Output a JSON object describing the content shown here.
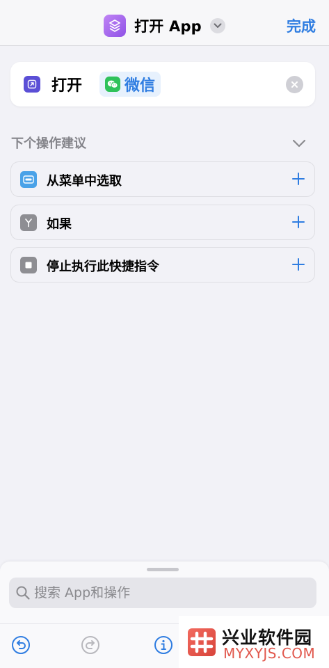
{
  "navbar": {
    "title": "打开 App",
    "done_label": "完成",
    "app_icon": "shortcuts-layers-icon",
    "title_chevron": "chevron-down-icon"
  },
  "action": {
    "verb": "打开",
    "app_name": "微信",
    "icon": "open-app-arrow-icon",
    "app_icon": "wechat-icon",
    "clear_icon": "clear-x-icon"
  },
  "suggestions": {
    "header": "下个操作建议",
    "items": [
      {
        "label": "从菜单中选取",
        "icon": "menu-list-icon",
        "icon_color": "#4aa2e8"
      },
      {
        "label": "如果",
        "icon": "branch-icon",
        "icon_color": "#8e8e93"
      },
      {
        "label": "停止执行此快捷指令",
        "icon": "stop-square-icon",
        "icon_color": "#8e8e93"
      }
    ]
  },
  "search": {
    "placeholder": "搜索 App和操作"
  },
  "toolbar": {
    "undo_icon": "undo-icon",
    "redo_icon": "redo-icon",
    "info_icon": "info-icon"
  },
  "watermark": {
    "title": "兴业软件园",
    "url": "MYXYJS.COM"
  },
  "colors": {
    "accent": "#2f7de1",
    "background": "#f2f2f7",
    "watermark_red": "#e1584d"
  }
}
